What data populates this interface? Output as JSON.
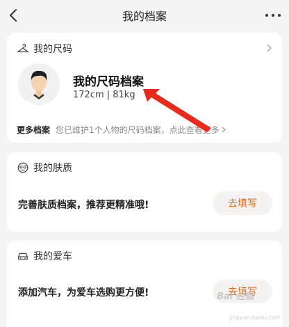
{
  "nav": {
    "title": "我的档案"
  },
  "size_card": {
    "header": "我的尺码",
    "profile_title": "我的尺码档案",
    "profile_stats": "172cm | 81kg",
    "more_label": "更多档案",
    "more_desc": "您已维护1个人物的尺码档案，点此查看更多"
  },
  "skin_card": {
    "header": "我的肤质",
    "promo": "完善肤质档案，推荐更精准哦!",
    "button": "去填写"
  },
  "car_card": {
    "header": "我的爱车",
    "promo": "添加汽车，为爱车选购更方便!",
    "button": "去填写"
  },
  "watermark": {
    "main": "Bai 经验",
    "sub": "jingyan.baidu.com"
  },
  "colors": {
    "accent": "#e36a1d",
    "annotation_arrow": "#e8291c"
  }
}
